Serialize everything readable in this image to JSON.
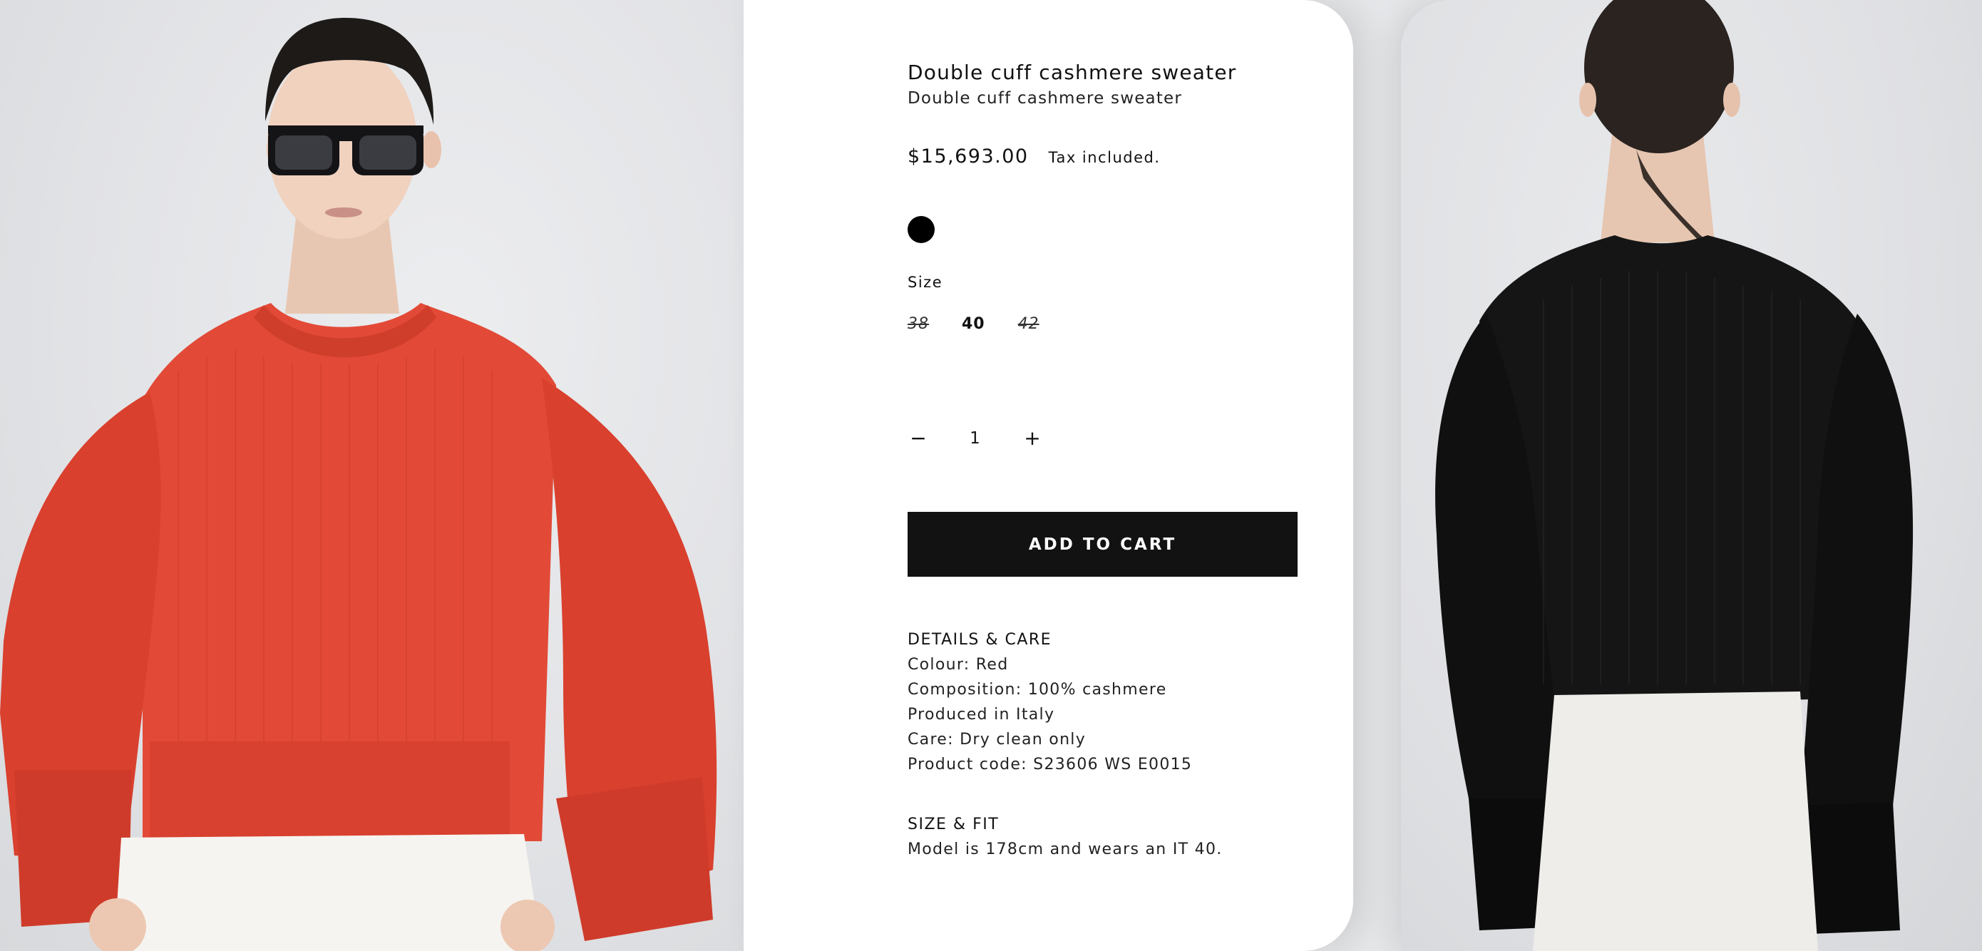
{
  "product": {
    "title": "Double cuff cashmere sweater",
    "subtitle": "Double cuff cashmere sweater",
    "price": "$15,693.00",
    "tax_note": "Tax included.",
    "colors": [
      {
        "name": "Black",
        "hex": "#000000",
        "selected": true
      }
    ],
    "size_label": "Size",
    "sizes": [
      {
        "label": "38",
        "available": false
      },
      {
        "label": "40",
        "available": true
      },
      {
        "label": "42",
        "available": false
      }
    ],
    "quantity": {
      "minus_symbol": "−",
      "value": "1",
      "plus_symbol": "+"
    },
    "add_to_cart_label": "ADD TO CART"
  },
  "details": {
    "heading": "DETAILS & CARE",
    "lines": [
      "Colour: Red",
      "Composition: 100% cashmere",
      "Produced in Italy",
      "Care: Dry clean only",
      "Product code: S23606 WS E0015"
    ]
  },
  "size_fit": {
    "heading": "SIZE & FIT",
    "lines": [
      "Model is 178cm and wears an IT 40."
    ]
  },
  "colors": {
    "sweater_front": "#e24a37",
    "sweater_back": "#151515",
    "button_bg": "#121212",
    "panel_bg": "#ffffff"
  }
}
